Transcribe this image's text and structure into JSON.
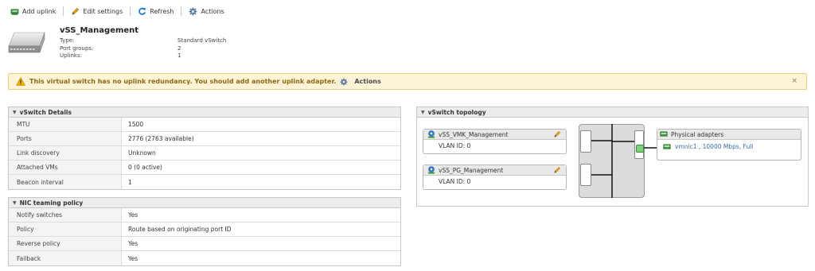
{
  "toolbar": {
    "add_uplink": "Add uplink",
    "edit_settings": "Edit settings",
    "refresh": "Refresh",
    "actions": "Actions"
  },
  "header": {
    "title": "vSS_Management",
    "meta": [
      {
        "key": "Type:",
        "value": "Standard vSwitch"
      },
      {
        "key": "Port groups:",
        "value": "2"
      },
      {
        "key": "Uplinks:",
        "value": "1"
      }
    ]
  },
  "warning": {
    "text": "This virtual switch has no uplink redundancy. You should add another uplink adapter.",
    "actions_label": "Actions",
    "close": "×"
  },
  "details": {
    "title": "vSwitch Details",
    "rows": [
      {
        "key": "MTU",
        "value": "1500"
      },
      {
        "key": "Ports",
        "value": "2776 (2763 available)"
      },
      {
        "key": "Link discovery",
        "value": "Unknown"
      },
      {
        "key": "Attached VMs",
        "value": "0 (0 active)"
      },
      {
        "key": "Beacon interval",
        "value": "1"
      }
    ]
  },
  "nic": {
    "title": "NIC teaming policy",
    "rows": [
      {
        "key": "Notify switches",
        "value": "Yes"
      },
      {
        "key": "Policy",
        "value": "Route based on originating port ID"
      },
      {
        "key": "Reverse policy",
        "value": "Yes"
      },
      {
        "key": "Failback",
        "value": "Yes"
      }
    ]
  },
  "topology": {
    "title": "vSwitch topology",
    "portgroups": [
      {
        "name": "vSS_VMK_Management",
        "vlan": "VLAN ID: 0"
      },
      {
        "name": "vSS_PG_Management",
        "vlan": "VLAN ID: 0"
      }
    ],
    "physical_title": "Physical adapters",
    "adapter": "vmnic1 , 10000 Mbps, Full"
  },
  "colors": {
    "warning_bg": "#fdf3d6",
    "warning_text": "#8a6a10",
    "link": "#3a6ea5",
    "refresh_blue": "#1a73c8"
  }
}
